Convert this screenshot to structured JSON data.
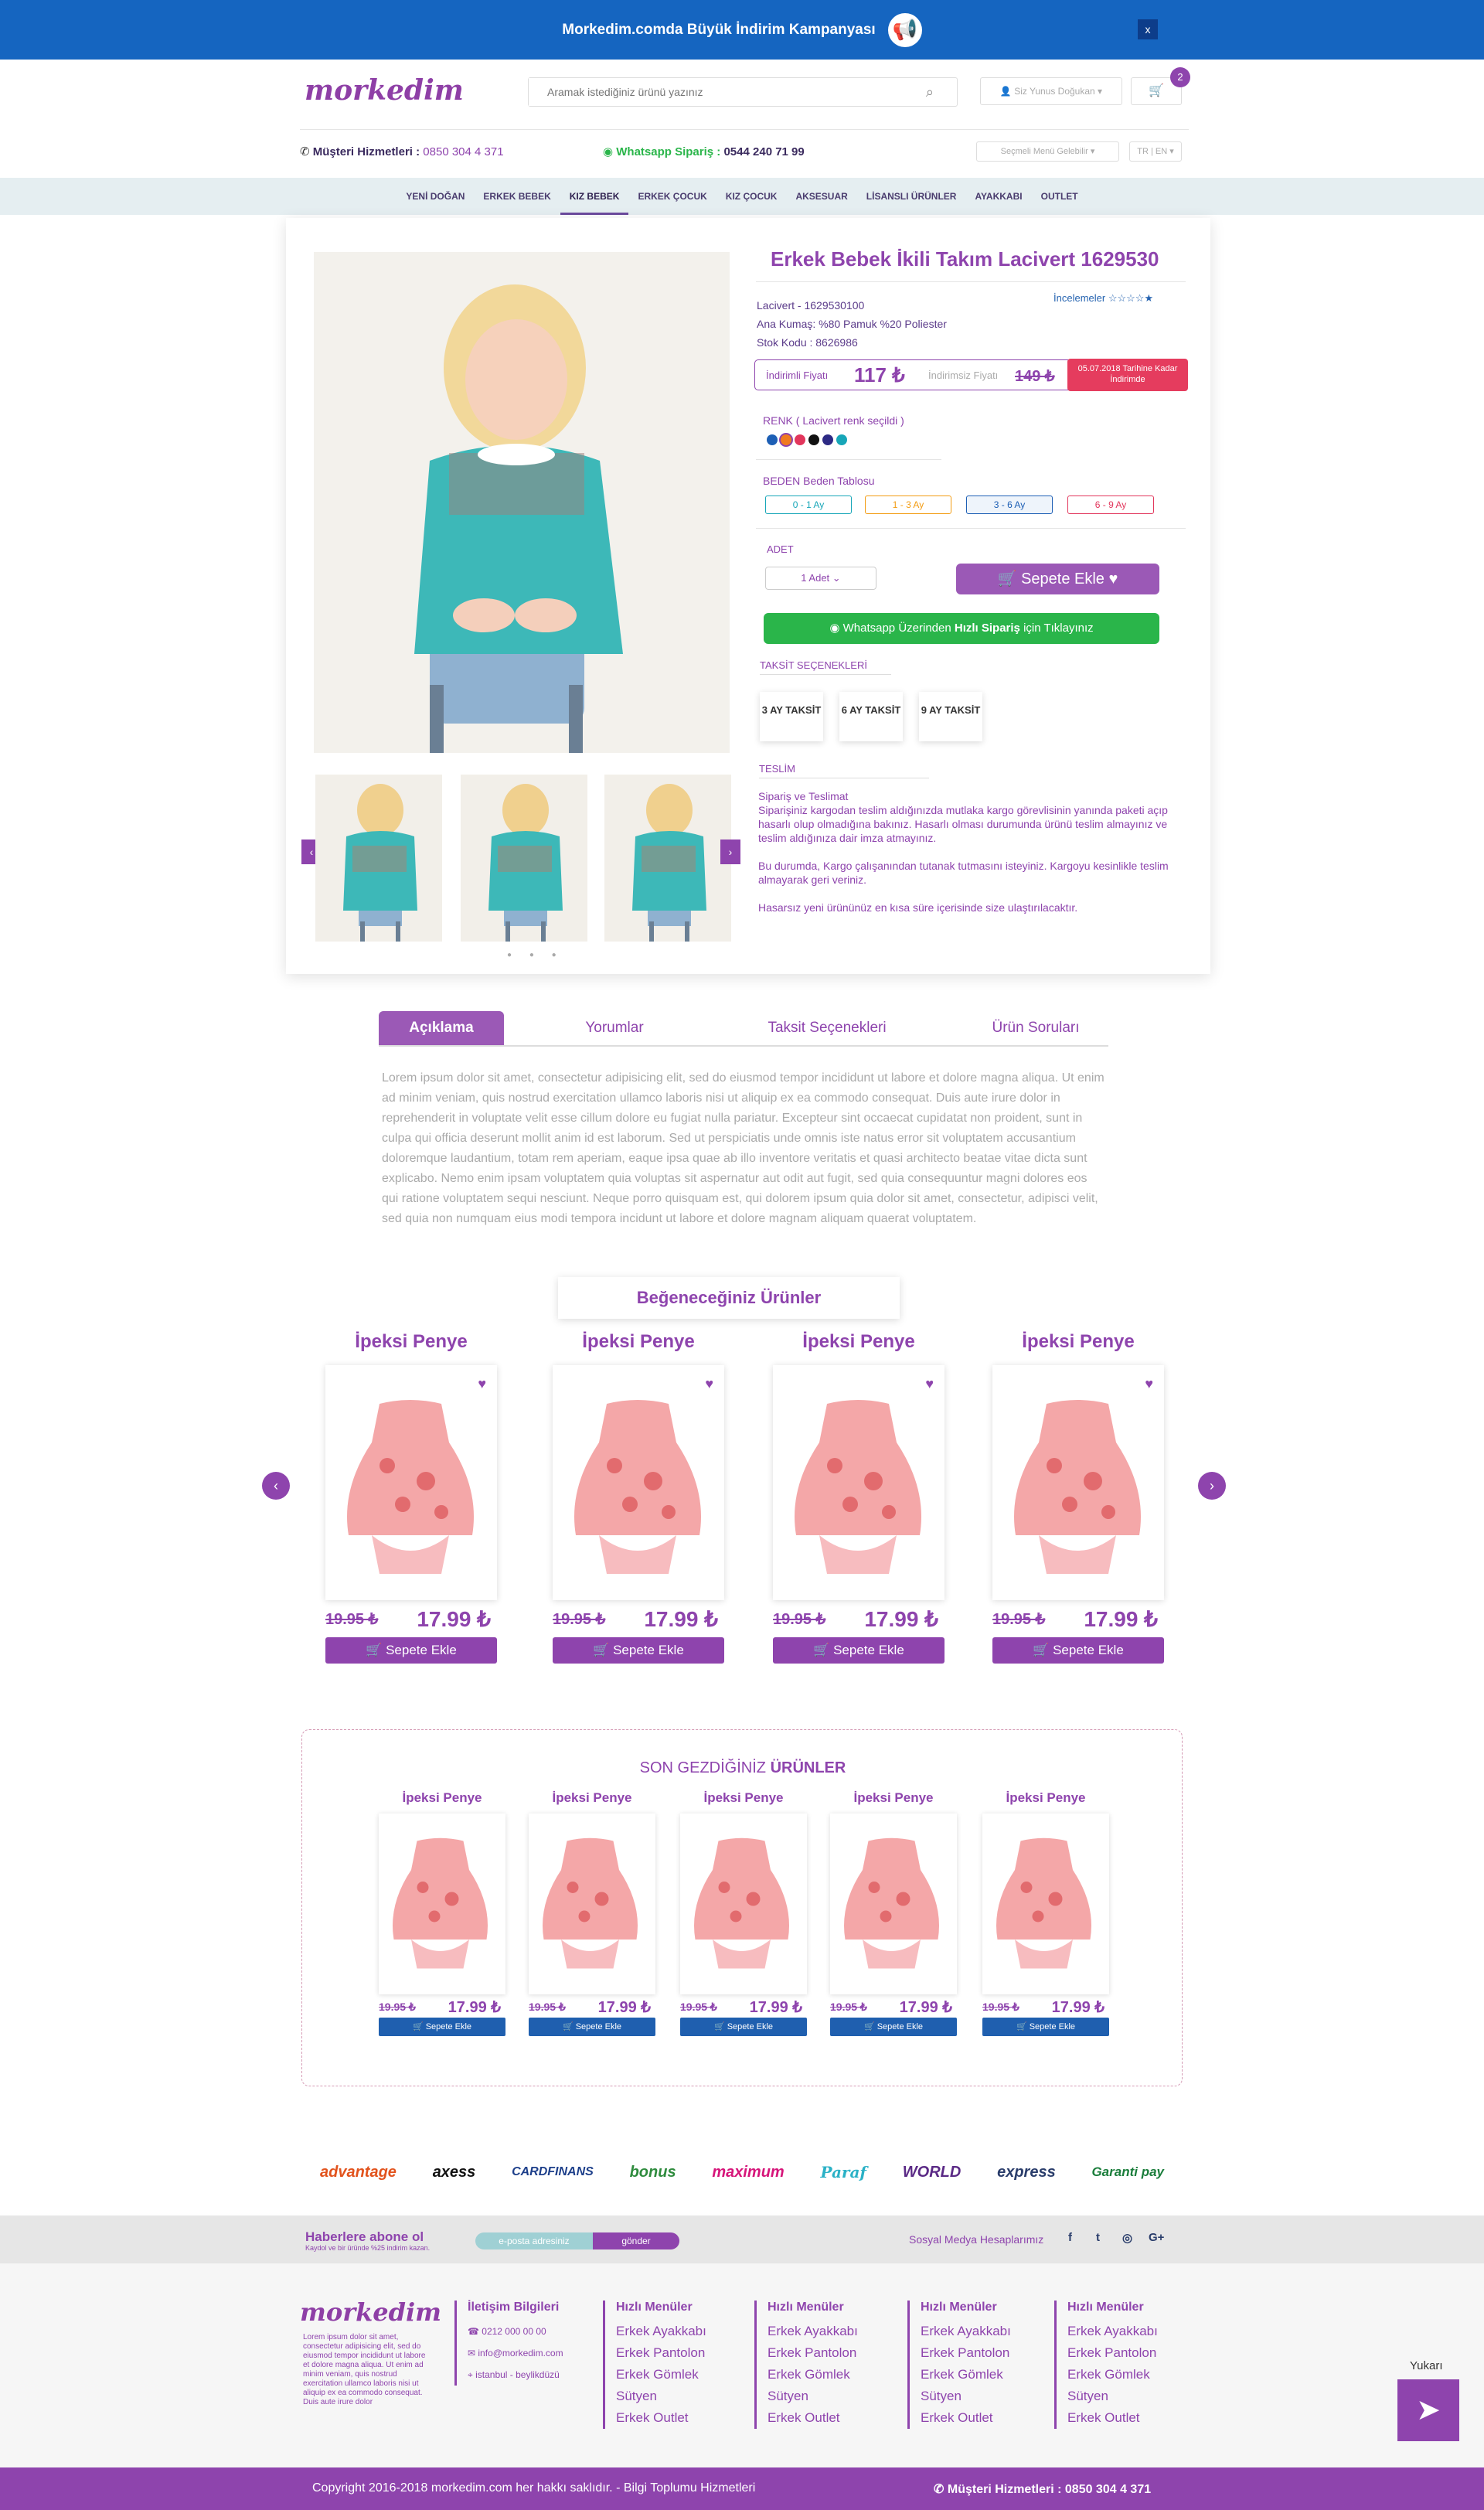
{
  "topbar": {
    "text": "Morkedim.comda Büyük İndirim Kampanyası",
    "close": "x"
  },
  "header": {
    "logo": "morkedim",
    "search_placeholder": "Aramak istediğiniz ürünü yazınız",
    "login": "Siz Yunus Doğukan",
    "cart_count": "2"
  },
  "contact": {
    "cs_label": "Müşteri Hizmetleri :",
    "cs_phone": "0850 304 4 371",
    "wa_label": "Whatsapp Sipariş :",
    "wa_phone": "0544 240 71 99",
    "menu_select": "Seçmeli Menü Gelebilir",
    "lang": "TR | EN"
  },
  "nav": [
    "YENİ DOĞAN",
    "ERKEK BEBEK",
    "KIZ BEBEK",
    "ERKEK ÇOCUK",
    "KIZ ÇOCUK",
    "AKSESUAR",
    "LİSANSLI ÜRÜNLER",
    "AYAKKABI",
    "OUTLET"
  ],
  "product": {
    "title": "Erkek Bebek İkili Takım Lacivert 1629530",
    "code": "Lacivert - 1629530100",
    "fabric": "Ana Kumaş: %80 Pamuk %20 Poliester",
    "stock": "Stok Kodu : 8626986",
    "reviews_label": "İncelemeler",
    "discount_label": "İndirimli Fiyatı",
    "price": "117 ₺",
    "regular_label": "İndirimsiz Fiyatı",
    "old_price": "149 ₺",
    "deadline": "05.07.2018 Tarihine Kadar İndirimde",
    "color_label": "RENK ( Lacivert renk seçildi )",
    "colors": [
      "#1d5fb5",
      "#f07a1f",
      "#e2365c",
      "#111111",
      "#2d2a84",
      "#17a6b8"
    ],
    "size_label": "BEDEN Beden Tablosu",
    "sizes": [
      "0 - 1 Ay",
      "1 - 3 Ay",
      "3 - 6 Ay",
      "6 - 9 Ay"
    ],
    "size_colors": [
      "#17a6b8",
      "#f39c12",
      "#1d5fb5",
      "#e2365c"
    ],
    "qty_label": "ADET",
    "qty": "1 Adet",
    "add_to_cart": "Sepete Ekle",
    "whatsapp_btn_a": "Whatsapp Üzerinden",
    "whatsapp_btn_b": "Hızlı Sipariş",
    "whatsapp_btn_c": "için Tıklayınız",
    "installment_label": "TAKSİT SEÇENEKLERİ",
    "installments": [
      "3 AY TAKSİT",
      "6 AY TAKSİT",
      "9 AY TAKSİT"
    ],
    "delivery_label": "TESLİM",
    "delivery_title": "Sipariş ve Teslimat",
    "delivery_p1": "Siparişiniz kargodan teslim aldığınızda mutlaka kargo görevlisinin yanında paketi açıp hasarlı olup olmadığına bakınız. Hasarlı olması durumunda ürünü teslim almayınız ve teslim aldığınıza dair imza atmayınız.",
    "delivery_p2": "Bu durumda, Kargo çalışanından tutanak tutmasını isteyiniz. Kargoyu kesinlikle teslim almayarak geri veriniz.",
    "delivery_p3": "Hasarsız yeni ürününüz en kısa süre içerisinde size ulaştırılacaktır."
  },
  "tabs": [
    "Açıklama",
    "Yorumlar",
    "Taksit Seçenekleri",
    "Ürün Soruları"
  ],
  "description": "Lorem ipsum dolor sit amet, consectetur adipisicing elit, sed do eiusmod tempor incididunt ut labore et dolore magna aliqua. Ut enim ad minim veniam, quis nostrud exercitation ullamco laboris nisi ut aliquip ex ea commodo consequat. Duis aute irure dolor in reprehenderit in voluptate velit esse cillum dolore eu fugiat nulla pariatur. Excepteur sint occaecat cupidatat non proident, sunt in culpa qui officia deserunt mollit anim id est laborum. Sed ut perspiciatis unde omnis iste natus error sit voluptatem accusantium doloremque laudantium, totam rem aperiam, eaque ipsa quae ab illo inventore veritatis et quasi architecto beatae vitae dicta sunt explicabo. Nemo enim ipsam voluptatem quia voluptas sit aspernatur aut odit aut fugit, sed quia consequuntur magni dolores eos qui ratione voluptatem sequi nesciunt. Neque porro quisquam est, qui dolorem ipsum quia dolor sit amet, consectetur, adipisci velit, sed quia non numquam eius modi tempora incidunt ut labore et dolore magnam aliquam quaerat voluptatem.",
  "likes": {
    "title": "Beğeneceğiniz Ürünler",
    "items": [
      {
        "name": "İpeksi Penye",
        "old": "19.95 ₺",
        "new": "17.99 ₺",
        "btn": "Sepete Ekle"
      },
      {
        "name": "İpeksi Penye",
        "old": "19.95 ₺",
        "new": "17.99 ₺",
        "btn": "Sepete Ekle"
      },
      {
        "name": "İpeksi Penye",
        "old": "19.95 ₺",
        "new": "17.99 ₺",
        "btn": "Sepete Ekle"
      },
      {
        "name": "İpeksi Penye",
        "old": "19.95 ₺",
        "new": "17.99 ₺",
        "btn": "Sepete Ekle"
      }
    ]
  },
  "recent": {
    "title_a": "SON GEZDİĞİNİZ",
    "title_b": "ÜRÜNLER",
    "items": [
      {
        "name": "İpeksi Penye",
        "old": "19.95 ₺",
        "new": "17.99 ₺",
        "btn": "Sepete Ekle"
      },
      {
        "name": "İpeksi Penye",
        "old": "19.95 ₺",
        "new": "17.99 ₺",
        "btn": "Sepete Ekle"
      },
      {
        "name": "İpeksi Penye",
        "old": "19.95 ₺",
        "new": "17.99 ₺",
        "btn": "Sepete Ekle"
      },
      {
        "name": "İpeksi Penye",
        "old": "19.95 ₺",
        "new": "17.99 ₺",
        "btn": "Sepete Ekle"
      },
      {
        "name": "İpeksi Penye",
        "old": "19.95 ₺",
        "new": "17.99 ₺",
        "btn": "Sepete Ekle"
      }
    ]
  },
  "banks": [
    {
      "name": "advantage",
      "color": "#e2531d"
    },
    {
      "name": "axess",
      "color": "#111111"
    },
    {
      "name": "CARDFINANS",
      "color": "#1d3f8a"
    },
    {
      "name": "bonus",
      "color": "#2e8b3d"
    },
    {
      "name": "maximum",
      "color": "#d6157a"
    },
    {
      "name": "Paraf",
      "color": "#2ab1c6"
    },
    {
      "name": "WORLD",
      "color": "#5b2a86"
    },
    {
      "name": "express",
      "color": "#2a3d6b"
    },
    {
      "name": "Garanti pay",
      "color": "#1a7d3b"
    }
  ],
  "newsletter": {
    "title": "Haberlere abone ol",
    "subtitle": "Kaydol ve bir üründe %25 indirim kazan.",
    "placeholder": "e-posta adresiniz",
    "button": "gönder",
    "social_label": "Sosyal Medya Hesaplarımız"
  },
  "footer": {
    "logo": "morkedim",
    "desc": "Lorem ipsum dolor sit amet, consectetur adipisicing elit, sed do eiusmod tempor incididunt ut labore et dolore magna aliqua. Ut enim ad minim veniam, quis nostrud exercitation ullamco laboris nisi ut aliquip ex ea commodo consequat. Duis aute irure dolor",
    "contact_title": "İletişim Bilgileri",
    "phone": "0212 000 00 00",
    "email": "info@morkedim.com",
    "address": "istanbul - beylikdüzü",
    "col_title": "Hızlı Menüler",
    "links": [
      "Erkek Ayakkabı",
      "Erkek Pantolon",
      "Erkek Gömlek",
      "Sütyen",
      "Erkek Outlet"
    ],
    "up_label": "Yukarı"
  },
  "bottom": {
    "copyright": "Copyright 2016-2018 morkedim.com her hakkı saklıdır. - Bilgi Toplumu Hizmetleri",
    "cs": "Müşteri Hizmetleri : 0850 304 4 371"
  }
}
